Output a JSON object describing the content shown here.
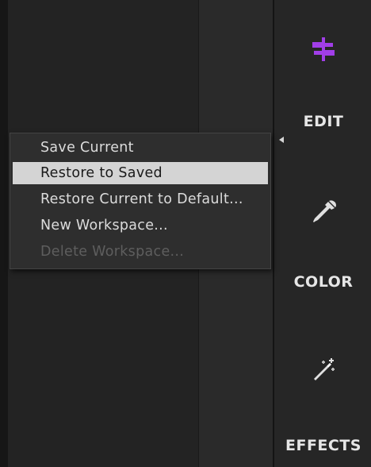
{
  "sidebar": {
    "items": [
      {
        "label": "EDIT",
        "icon": "edit-sliders-icon",
        "active": true
      },
      {
        "label": "COLOR",
        "icon": "eyedropper-icon",
        "active": false
      },
      {
        "label": "EFFECTS",
        "icon": "magic-wand-icon",
        "active": false
      }
    ]
  },
  "context_menu": {
    "items": [
      {
        "label": "Save Current",
        "state": "normal"
      },
      {
        "label": "Restore to Saved",
        "state": "highlighted"
      },
      {
        "label": "Restore Current to Default...",
        "state": "normal"
      },
      {
        "label": "New Workspace...",
        "state": "normal"
      },
      {
        "label": "Delete Workspace...",
        "state": "disabled"
      }
    ]
  },
  "colors": {
    "accent": "#a13ee8",
    "text": "#e6e6e6",
    "highlight": "#d4d4d4",
    "disabled_text": "#5e5e5e"
  }
}
